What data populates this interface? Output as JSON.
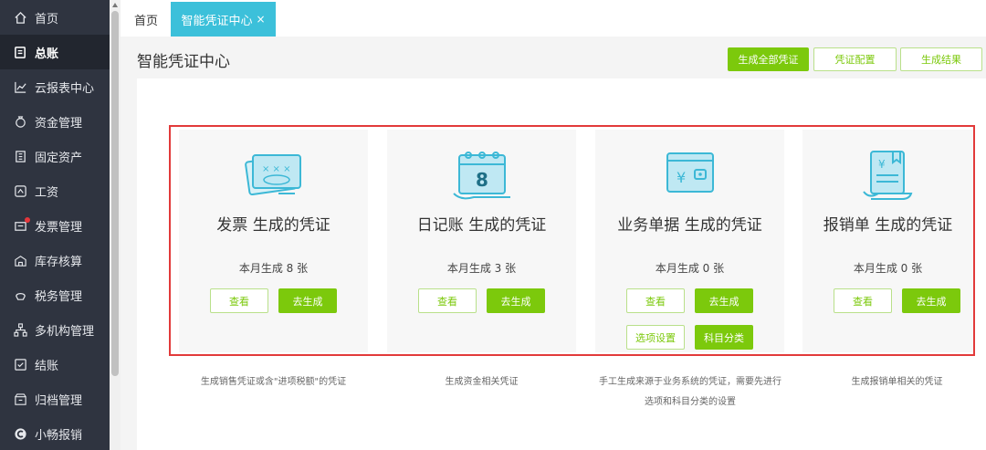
{
  "sidebar": {
    "items": [
      {
        "label": "首页",
        "icon": "home-icon"
      },
      {
        "label": "总账",
        "icon": "ledger-icon"
      },
      {
        "label": "云报表中心",
        "icon": "chart-icon"
      },
      {
        "label": "资金管理",
        "icon": "money-bag-icon"
      },
      {
        "label": "固定资产",
        "icon": "asset-icon"
      },
      {
        "label": "工资",
        "icon": "payroll-icon"
      },
      {
        "label": "发票管理",
        "icon": "invoice-icon"
      },
      {
        "label": "库存核算",
        "icon": "warehouse-icon"
      },
      {
        "label": "税务管理",
        "icon": "tax-icon"
      },
      {
        "label": "多机构管理",
        "icon": "org-icon"
      },
      {
        "label": "结账",
        "icon": "checkout-icon"
      },
      {
        "label": "归档管理",
        "icon": "archive-icon"
      },
      {
        "label": "小畅报销",
        "icon": "expense-icon"
      }
    ]
  },
  "tabs": {
    "home": "首页",
    "active": "智能凭证中心",
    "close": "×"
  },
  "header": {
    "title": "智能凭证中心",
    "btn_generate_all": "生成全部凭证",
    "btn_config": "凭证配置",
    "btn_result": "生成结果"
  },
  "cards": [
    {
      "title": "发票 生成的凭证",
      "count": "本月生成 8 张",
      "view": "查看",
      "go": "去生成",
      "desc1": "生成销售凭证或含\"进项税额\"的凭证",
      "desc2": ""
    },
    {
      "title": "日记账 生成的凭证",
      "count": "本月生成 3 张",
      "view": "查看",
      "go": "去生成",
      "desc1": "生成资金相关凭证",
      "desc2": ""
    },
    {
      "title": "业务单据 生成的凭证",
      "count": "本月生成  0 张",
      "view": "查看",
      "go": "去生成",
      "extra1": "选项设置",
      "extra2": "科目分类",
      "desc1": "手工生成来源于业务系统的凭证，需要先进行",
      "desc2": "选项和科目分类的设置"
    },
    {
      "title": "报销单 生成的凭证",
      "count": "本月生成  0 张",
      "view": "查看",
      "go": "去生成",
      "desc1": "生成报销单相关的凭证",
      "desc2": ""
    }
  ],
  "colors": {
    "accent": "#7cc90c",
    "tab": "#3cc0da",
    "sidebar": "#2f3440",
    "highlight": "#e23a3a"
  }
}
